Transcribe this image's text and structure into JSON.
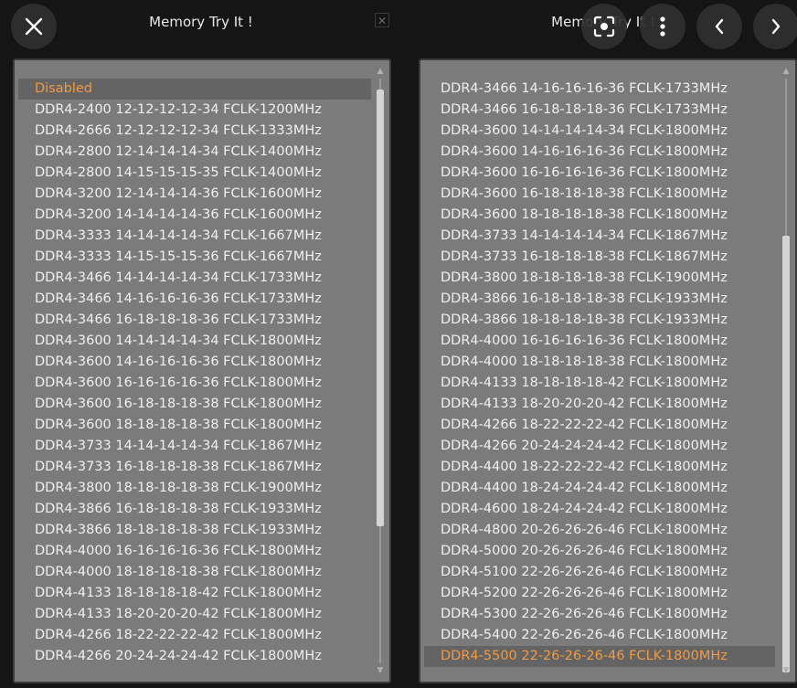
{
  "header": {
    "close_label": "✕",
    "left_title": "Memory Try It !",
    "right_title": "Memory Try It !",
    "small_close": "✕"
  },
  "overlay_buttons": {
    "lens": "lens-icon",
    "more": "⋮",
    "prev": "‹",
    "next": "›"
  },
  "left_list": {
    "items": [
      "Disabled",
      "DDR4-2400 12-12-12-12-34 FCLK-1200MHz",
      "DDR4-2666 12-12-12-12-34 FCLK-1333MHz",
      "DDR4-2800 12-14-14-14-34 FCLK-1400MHz",
      "DDR4-2800 14-15-15-15-35 FCLK-1400MHz",
      "DDR4-3200 12-14-14-14-36 FCLK-1600MHz",
      "DDR4-3200 14-14-14-14-36 FCLK-1600MHz",
      "DDR4-3333 14-14-14-14-34 FCLK-1667MHz",
      "DDR4-3333 14-15-15-15-36 FCLK-1667MHz",
      "DDR4-3466 14-14-14-14-34 FCLK-1733MHz",
      "DDR4-3466 14-16-16-16-36 FCLK-1733MHz",
      "DDR4-3466 16-18-18-18-36 FCLK-1733MHz",
      "DDR4-3600 14-14-14-14-34 FCLK-1800MHz",
      "DDR4-3600 14-16-16-16-36 FCLK-1800MHz",
      "DDR4-3600 16-16-16-16-36 FCLK-1800MHz",
      "DDR4-3600 16-18-18-18-38 FCLK-1800MHz",
      "DDR4-3600 18-18-18-18-38 FCLK-1800MHz",
      "DDR4-3733 14-14-14-14-34 FCLK-1867MHz",
      "DDR4-3733 16-18-18-18-38 FCLK-1867MHz",
      "DDR4-3800 18-18-18-18-38 FCLK-1900MHz",
      "DDR4-3866 16-18-18-18-38 FCLK-1933MHz",
      "DDR4-3866 18-18-18-18-38 FCLK-1933MHz",
      "DDR4-4000 16-16-16-16-36 FCLK-1800MHz",
      "DDR4-4000 18-18-18-18-38 FCLK-1800MHz",
      "DDR4-4133 18-18-18-18-42 FCLK-1800MHz",
      "DDR4-4133 18-20-20-20-42 FCLK-1800MHz",
      "DDR4-4266 18-22-22-22-42 FCLK-1800MHz",
      "DDR4-4266 20-24-24-24-42 FCLK-1800MHz"
    ],
    "selected_index": 0,
    "scroll_position": 0.0
  },
  "right_list": {
    "items": [
      "DDR4-3466 14-16-16-16-36 FCLK-1733MHz",
      "DDR4-3466 16-18-18-18-36 FCLK-1733MHz",
      "DDR4-3600 14-14-14-14-34 FCLK-1800MHz",
      "DDR4-3600 14-16-16-16-36 FCLK-1800MHz",
      "DDR4-3600 16-16-16-16-36 FCLK-1800MHz",
      "DDR4-3600 16-18-18-18-38 FCLK-1800MHz",
      "DDR4-3600 18-18-18-18-38 FCLK-1800MHz",
      "DDR4-3733 14-14-14-14-34 FCLK-1867MHz",
      "DDR4-3733 16-18-18-18-38 FCLK-1867MHz",
      "DDR4-3800 18-18-18-18-38 FCLK-1900MHz",
      "DDR4-3866 16-18-18-18-38 FCLK-1933MHz",
      "DDR4-3866 18-18-18-18-38 FCLK-1933MHz",
      "DDR4-4000 16-16-16-16-36 FCLK-1800MHz",
      "DDR4-4000 18-18-18-18-38 FCLK-1800MHz",
      "DDR4-4133 18-18-18-18-42 FCLK-1800MHz",
      "DDR4-4133 18-20-20-20-42 FCLK-1800MHz",
      "DDR4-4266 18-22-22-22-42 FCLK-1800MHz",
      "DDR4-4266 20-24-24-24-42 FCLK-1800MHz",
      "DDR4-4400 18-22-22-22-42 FCLK-1800MHz",
      "DDR4-4400 18-24-24-24-42 FCLK-1800MHz",
      "DDR4-4600 18-24-24-24-42 FCLK-1800MHz",
      "DDR4-4800 20-26-26-26-46 FCLK-1800MHz",
      "DDR4-5000 20-26-26-26-46 FCLK-1800MHz",
      "DDR4-5100 22-26-26-26-46 FCLK-1800MHz",
      "DDR4-5200 22-26-26-26-46 FCLK-1800MHz",
      "DDR4-5300 22-26-26-26-46 FCLK-1800MHz",
      "DDR4-5400 22-26-26-26-46 FCLK-1800MHz",
      "DDR4-5500 22-26-26-26-46 FCLK-1800MHz"
    ],
    "selected_index": 27,
    "scroll_position": 1.0
  },
  "colors": {
    "selected_text": "#f09a45",
    "item_text": "#f0f0f0",
    "panel_bg": "#7b7b7b",
    "page_bg": "#151515"
  }
}
